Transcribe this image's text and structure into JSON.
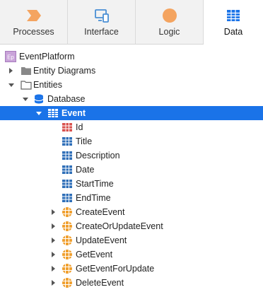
{
  "tabs": [
    {
      "label": "Processes",
      "icon": "processes-icon"
    },
    {
      "label": "Interface",
      "icon": "interface-icon"
    },
    {
      "label": "Logic",
      "icon": "logic-icon"
    },
    {
      "label": "Data",
      "icon": "data-icon",
      "active": true
    }
  ],
  "tree": {
    "app_badge": "Ep",
    "app": "EventPlatform",
    "entity_diagrams": "Entity Diagrams",
    "entities": "Entities",
    "database": "Database",
    "entity": "Event",
    "attributes": [
      "Id",
      "Title",
      "Description",
      "Date",
      "StartTime",
      "EndTime"
    ],
    "actions": [
      "CreateEvent",
      "CreateOrUpdateEvent",
      "UpdateEvent",
      "GetEvent",
      "GetEventForUpdate",
      "DeleteEvent"
    ]
  },
  "colors": {
    "selected": "#1a73e8",
    "processes": "#f4a460",
    "interface": "#4a8fd4",
    "logic": "#f4a460",
    "data": "#1a73e8",
    "action": "#f0a030",
    "id_attribute": "#d9534f"
  }
}
